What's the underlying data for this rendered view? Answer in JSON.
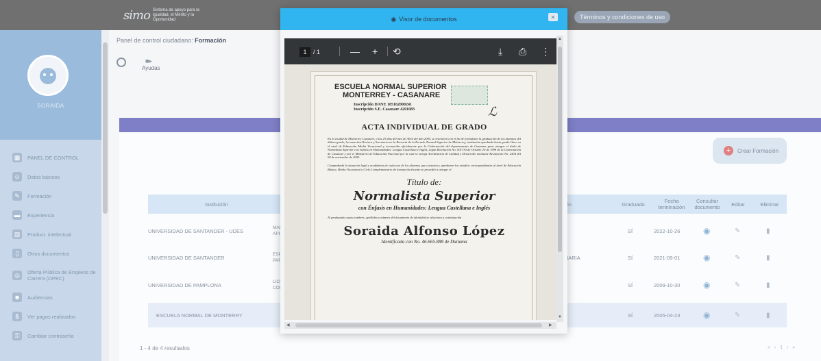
{
  "app": {
    "logo_mark": "simo",
    "logo_text": "Sistema de apoyo para la igualdad, el Mérito y la Oportunidad",
    "terms_label": "Términos y condiciones de uso"
  },
  "sidebar": {
    "user_name": "SORAIDA",
    "items": [
      {
        "label": "PANEL DE CONTROL",
        "icon": "dashboard-icon",
        "glyph": "▦"
      },
      {
        "label": "Datos básicos",
        "icon": "people-icon",
        "glyph": "☺"
      },
      {
        "label": "Formación",
        "icon": "graduation-icon",
        "glyph": "✎"
      },
      {
        "label": "Experiencia",
        "icon": "briefcase-icon",
        "glyph": "▬"
      },
      {
        "label": "Product. intelectual",
        "icon": "book-icon",
        "glyph": "▤"
      },
      {
        "label": "Otros documentos",
        "icon": "document-icon",
        "glyph": "▯"
      },
      {
        "label": "Oferta Pública de Empleos de Carrera (OPEC)",
        "icon": "globe-icon",
        "glyph": "◎"
      },
      {
        "label": "Audiencias",
        "icon": "audience-icon",
        "glyph": "☻"
      },
      {
        "label": "Ver pagos realizados",
        "icon": "payment-icon",
        "glyph": "$"
      },
      {
        "label": "Cambiar contraseña",
        "icon": "lock-icon",
        "glyph": "⚿"
      }
    ]
  },
  "main": {
    "breadcrumb_prefix": "Panel de control ciudadano:",
    "breadcrumb_current": "Formación",
    "help_label": "Ayudas",
    "create_button": "Crear Formación",
    "table": {
      "headers": {
        "institucion": "Institución",
        "programa": "ación",
        "graduado": "Graduado",
        "fecha": "Fecha terminación",
        "consultar": "Consultar documento",
        "editar": "Editar",
        "eliminar": "Eliminar"
      },
      "rows": [
        {
          "institucion": "UNIVERSIDAD DE SANTANDER - UDES",
          "col2": "MAES APLIC",
          "col3": "",
          "graduado": "SÍ",
          "fecha": "2022-10-26"
        },
        {
          "institucion": "UNIVERSIDAD DE SANTANDER",
          "col2": "ESPE PARA",
          "col3": "MARIA",
          "graduado": "SÍ",
          "fecha": "2021-09-01"
        },
        {
          "institucion": "UNIVERSIDAD DE PAMPLONA",
          "col2": "LICEI COM",
          "col3": "",
          "graduado": "SÍ",
          "fecha": "2009-10-30"
        },
        {
          "institucion": "ESCUELA NORMAL DE MONTERRY",
          "col2": "NO",
          "col3": "",
          "graduado": "SÍ",
          "fecha": "2005-04-23"
        }
      ]
    },
    "results_text": "1 - 4 de 4 resultados",
    "pager_text": "« ‹ 1 › »"
  },
  "modal": {
    "title": "Visor de documentos",
    "close_glyph": "✕",
    "pdf": {
      "current_page": "1",
      "total_pages": "/ 1",
      "zoom_out": "—",
      "zoom_in": "+",
      "rotate_glyph": "⟲",
      "download_glyph": "⤓",
      "print_glyph": "⎙",
      "more_glyph": "⋮"
    },
    "document": {
      "school_line1": "ESCUELA NORMAL SUPERIOR",
      "school_line2": "MONTERREY - CASANARE",
      "inscription1": "Inscripción DANE 185162000241",
      "inscription2": "Inscripción S.E. Casanare 4201083",
      "heading": "ACTA INDIVIDUAL DE GRADO",
      "paragraph1": "En la ciudad de Monterrey Casanare, a los 23 días del mes de Abril del año 2005, se reunieron con el fin de formalizar la graduación de los alumnos del último grado, los suscritos Rectora y Secretaria en la Rectoría de la Escuela Normal Superior de Monterrey, institución aprobada hasta grado Once en el nivel de Educación Media Vocacional y reconocida oficialmente por la Gobernación del departamento de Casanare para otorgar el título de Normalista Superior con énfasis en Humanidades: Lengua Castellana e Inglés, según Resolución No. 001730 de Octubre 20 de 1998 de la Gobernación de Casanare y por el Ministerio de Educación Nacional por la cual se otorga Acreditación de Calidad y Desarrollo mediante Resolución No. 2434 del 04 de noviembre de 2003.",
      "paragraph2": "Comprobada la situación legal y académica de cada uno de los alumnos que cursaron y aprobaron los estudios correspondientes al nivel de Educación Básica, Media Vocacional y Ciclo Complementario de formación docente se procedió a otorgar el",
      "title_de": "Título de:",
      "title_main": "Normalista Superior",
      "title_enfasis": "con Énfasis en Humanidades: Lengua Castellana e Inglés",
      "paragraph3": "Al graduando cuyos nombres, apellidos y número del documento de identidad se relaciona a continuación",
      "graduate_name": "Soraida Alfonso López",
      "identification": "Identificada con No. 46.665.888 de Duitama"
    }
  }
}
